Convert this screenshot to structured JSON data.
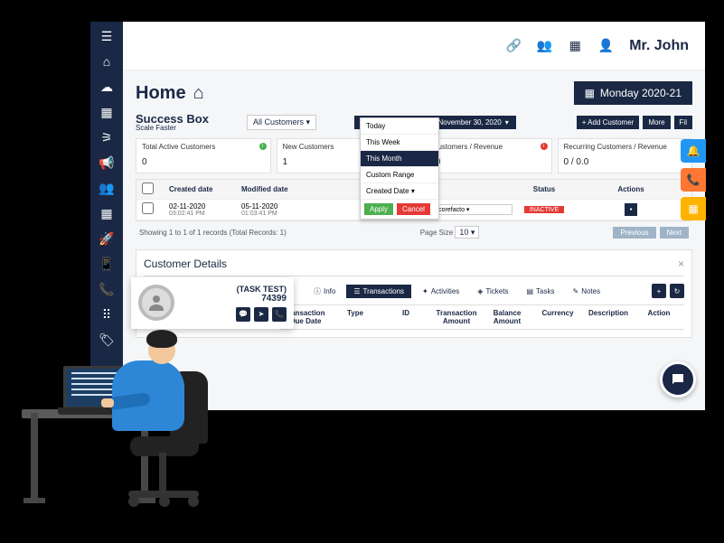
{
  "header": {
    "username": "Mr. John"
  },
  "page": {
    "title": "Home",
    "date_badge": "Monday 2020-21"
  },
  "brand": {
    "name": "Success Box",
    "tagline": "Scale Faster"
  },
  "toolbar": {
    "customer_filter": "All Customers",
    "date_range": "November 1, 2020 - November 30, 2020",
    "add_btn": "+ Add Customer",
    "more_btn": "More",
    "filter_btn": "Fil"
  },
  "date_popup": {
    "options": [
      "Today",
      "This Week",
      "This Month",
      "Custom Range"
    ],
    "selected": "This Month",
    "field_select": "Created Date",
    "apply": "Apply",
    "cancel": "Cancel"
  },
  "stats": [
    {
      "label": "Total Active Customers",
      "value": "0",
      "dot": "#4caf50",
      "info": "i"
    },
    {
      "label": "New Customers",
      "value": "1",
      "dot": "#2196f3",
      "info": "i"
    },
    {
      "label": "tal Customers / Revenue",
      "value": " / 0.0",
      "dot": "#e53935",
      "info": "i"
    },
    {
      "label": "Recurring Customers / Revenue",
      "value": "0 / 0.0",
      "dot": "#4caf50",
      "info": "i"
    }
  ],
  "table": {
    "headers": [
      "",
      "Created date",
      "Modified date",
      "",
      "Manager",
      "Status",
      "Actions"
    ],
    "rows": [
      {
        "created": "02-11-2020",
        "created_t": "03:02:41 PM",
        "modified": "05-11-2020",
        "modified_t": "01:03:41 PM",
        "manager": "pankaj.k@corefacto",
        "status": "INACTIVE"
      }
    ],
    "footer_left": "Showing 1 to 1 of 1 records (Total Records: 1)",
    "page_size_label": "Page Size",
    "page_size": "10",
    "prev": "Previous",
    "next": "Next"
  },
  "details": {
    "title": "Customer Details",
    "customer_name": "(TASK TEST)",
    "customer_id": "74399",
    "tabs": [
      "Info",
      "Transactions",
      "Activities",
      "Tickets",
      "Tasks",
      "Notes"
    ],
    "active_tab": "Transactions",
    "trans_headers": [
      "Transaction /Due Date",
      "Type",
      "ID",
      "Transaction Amount",
      "Balance Amount",
      "Currency",
      "Description",
      "Action"
    ]
  },
  "icons": {
    "menu": "☰",
    "home": "⌂",
    "cloud": "☁",
    "calendar": "▦",
    "sitemap": "⚞",
    "megaphone": "📣",
    "users": "👥",
    "grid": "▤",
    "rocket": "🚀",
    "mobile": "📱",
    "phone": "📞",
    "apps": "⋮⋮⋮",
    "tag": "🏷",
    "link": "🔗",
    "th": "⊞",
    "user": "👤",
    "chat": "💬",
    "plus": "+",
    "refresh": "↻"
  }
}
